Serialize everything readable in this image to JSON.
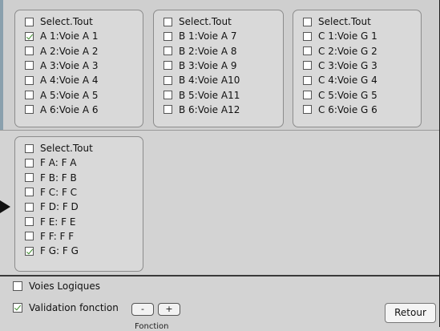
{
  "groups": [
    {
      "items": [
        {
          "label": "Select.Tout",
          "checked": false
        },
        {
          "label": "A 1:Voie A 1",
          "checked": true
        },
        {
          "label": "A 2:Voie A 2",
          "checked": false
        },
        {
          "label": "A 3:Voie A 3",
          "checked": false
        },
        {
          "label": "A 4:Voie A 4",
          "checked": false
        },
        {
          "label": "A 5:Voie A 5",
          "checked": false
        },
        {
          "label": "A 6:Voie A 6",
          "checked": false
        }
      ]
    },
    {
      "items": [
        {
          "label": "Select.Tout",
          "checked": false
        },
        {
          "label": "B 1:Voie A 7",
          "checked": false
        },
        {
          "label": "B 2:Voie A 8",
          "checked": false
        },
        {
          "label": "B 3:Voie A 9",
          "checked": false
        },
        {
          "label": "B 4:Voie A10",
          "checked": false
        },
        {
          "label": "B 5:Voie A11",
          "checked": false
        },
        {
          "label": "B 6:Voie A12",
          "checked": false
        }
      ]
    },
    {
      "items": [
        {
          "label": "Select.Tout",
          "checked": false
        },
        {
          "label": "C 1:Voie G 1",
          "checked": false
        },
        {
          "label": "C 2:Voie G 2",
          "checked": false
        },
        {
          "label": "C 3:Voie G 3",
          "checked": false
        },
        {
          "label": "C 4:Voie G 4",
          "checked": false
        },
        {
          "label": "C 5:Voie G 5",
          "checked": false
        },
        {
          "label": "C 6:Voie G 6",
          "checked": false
        }
      ]
    },
    {
      "items": [
        {
          "label": "Select.Tout",
          "checked": false
        },
        {
          "label": "F A: F A",
          "checked": false
        },
        {
          "label": "F B: F B",
          "checked": false
        },
        {
          "label": "F C: F C",
          "checked": false
        },
        {
          "label": "F D: F D",
          "checked": false
        },
        {
          "label": "F E: F E",
          "checked": false
        },
        {
          "label": "F F: F F",
          "checked": false
        },
        {
          "label": "F G: F G",
          "checked": true
        }
      ]
    }
  ],
  "bottom": {
    "voies_logiques": {
      "label": "Voies Logiques",
      "checked": false
    },
    "validation_fonction": {
      "label": "Validation fonction",
      "checked": true
    },
    "minus_label": "-",
    "plus_label": "+",
    "retour_label": "Retour",
    "cut_text": "Fonction"
  },
  "colors": {
    "check": "#3a8a2a",
    "panel_bg": "#d9d9d9",
    "window_bg": "#d3d3d3"
  }
}
